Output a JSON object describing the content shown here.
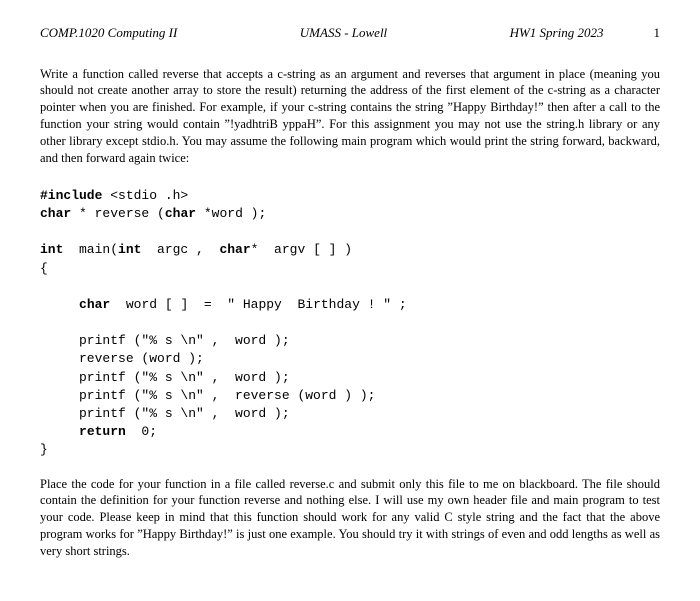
{
  "header": {
    "left": "COMP.1020 Computing II",
    "center": "UMASS - Lowell",
    "right": "HW1 Spring 2023",
    "page_num": "1"
  },
  "para1": "Write a function called reverse that accepts a c-string as an argument and reverses that argument in place (meaning you should not create another array to store the result) returning the address of the first element of the c-string as a character pointer when you are finished. For example, if your c-string contains the string ”Happy Birthday!” then after a call to the function your string would contain ”!yadhtriB yppaH”. For this assignment you may not use the string.h library or any other library except stdio.h. You may assume the following main program which would print the string forward, backward, and then forward again twice:",
  "code": {
    "l1a": "#include",
    "l1b": " <stdio .h>",
    "l2a": "char",
    "l2b": " * reverse (",
    "l2c": "char",
    "l2d": " *word );",
    "l3a": "int",
    "l3b": "  main(",
    "l3c": "int",
    "l3d": "  argc ,  ",
    "l3e": "char",
    "l3f": "*  argv [ ] )",
    "l4": "{",
    "l5a": "char",
    "l5b": "  word [ ]  =  \" Happy  Birthday ! \" ;",
    "l6": "     printf (\"% s \\n\" ,  word );",
    "l7": "     reverse (word );",
    "l8": "     printf (\"% s \\n\" ,  word );",
    "l9": "     printf (\"% s \\n\" ,  reverse (word ) );",
    "l10": "     printf (\"% s \\n\" ,  word );",
    "l11a": "return",
    "l11b": "  0;",
    "l12": "}"
  },
  "para2": "Place the code for your function in a file called reverse.c and submit only this file to me on blackboard. The file should contain the definition for your function reverse and nothing else. I will use my own header file and main program to test your code. Please keep in mind that this function should work for any valid C style string and the fact that the above program works for ”Happy Birthday!” is just one example. You should try it with strings of even and odd lengths as well as very short strings."
}
